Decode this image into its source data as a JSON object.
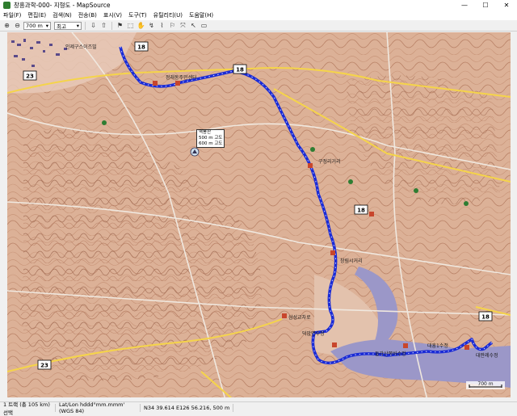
{
  "window": {
    "title": "창흥과학-000- 지형도 - MapSource",
    "minimize": "—",
    "maximize": "☐",
    "close": "✕"
  },
  "menu": [
    "파일(F)",
    "편집(E)",
    "검색(N)",
    "전송(B)",
    "표시(V)",
    "도구(T)",
    "유틸리티(U)",
    "도움말(H)"
  ],
  "toolbar": {
    "zoom_value": "700 m",
    "detail_value": "최고"
  },
  "map_labels": {
    "hwy_18": "18",
    "hwy_23": "23",
    "place_top": "인제구스이즈빌",
    "place_mid": "정래동주민센터",
    "place_mid2": "구정리거리",
    "place_south": "창림시거리",
    "place_junction": "삼성교차로",
    "place_se1": "덕암면수정",
    "place_se2": "둘각산쪽바수정",
    "place_se3": "대흥1수정",
    "place_se4": "대판례수정",
    "peak_name": "역봉산",
    "peak_alt1": "500 m 고도",
    "peak_alt2": "600 m 고도",
    "scale": "700 m"
  },
  "status": {
    "track": "1 트랙 (총 105 km) 선택",
    "format": "Lat/Lon hddd°mm.mmm' (WGS 84)",
    "coords": "N34 39.614 E126 56.216, 500 m"
  },
  "colors": {
    "route": "#1a2bd6",
    "terrain": "#d9a98c",
    "water": "#9b97c8",
    "road_yellow": "#f5d44a"
  }
}
